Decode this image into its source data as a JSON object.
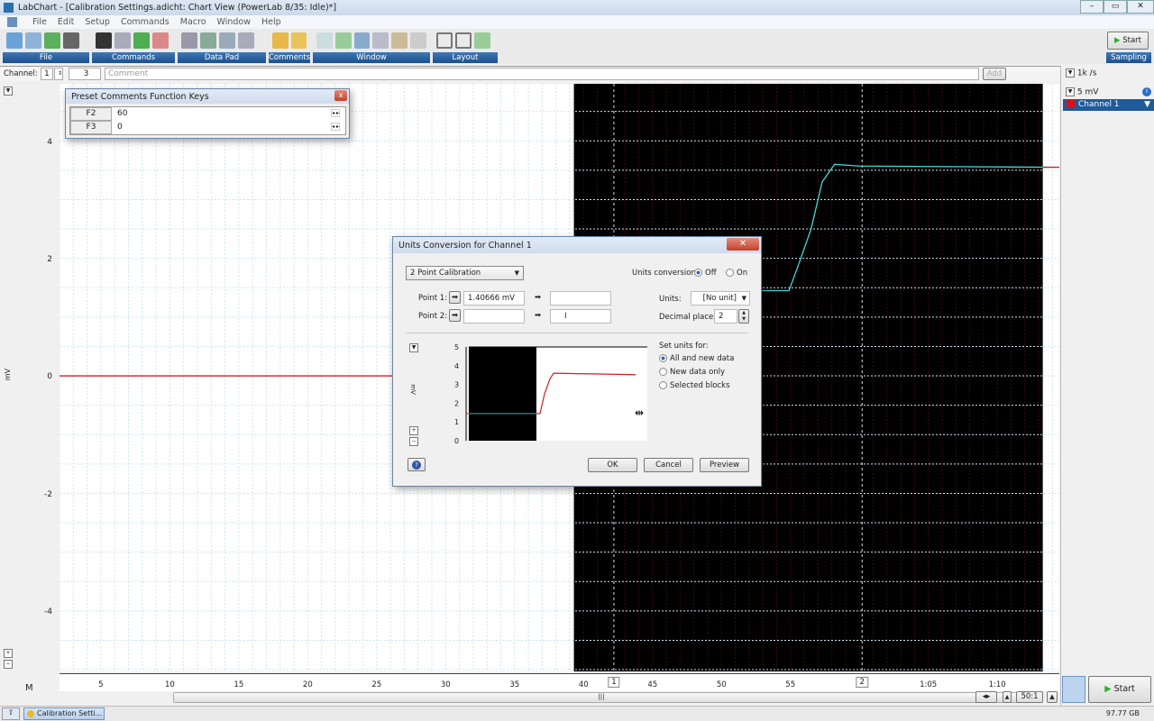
{
  "window": {
    "title": "LabChart - [Calibration Settings.adicht: Chart View (PowerLab 8/35: Idle)*]"
  },
  "menu": [
    "File",
    "Edit",
    "Setup",
    "Commands",
    "Macro",
    "Window",
    "Help"
  ],
  "toolbar": {
    "groups": [
      "File",
      "Commands",
      "Data Pad",
      "Comments",
      "Window",
      "Layout"
    ],
    "start_label": "Start",
    "sampling_label": "Sampling"
  },
  "channel_bar": {
    "label": "Channel:",
    "channel_value": "1",
    "comment_number": "3",
    "comment_placeholder": "Comment",
    "add_label": "Add"
  },
  "right_panel": {
    "rate": "1k /s",
    "range": "5 mV",
    "channel_name": "Channel 1",
    "channel_color": "#e01010"
  },
  "preset_comments": {
    "title": "Preset Comments Function Keys",
    "rows": [
      {
        "key": "F2",
        "value": "60"
      },
      {
        "key": "F3",
        "value": "0"
      }
    ]
  },
  "chart": {
    "y_unit": "mV",
    "y_ticks": [
      "4",
      "2",
      "0",
      "-2",
      "-4"
    ],
    "x_ticks": [
      "5",
      "10",
      "15",
      "20",
      "25",
      "30",
      "35",
      "40",
      "45",
      "50",
      "55",
      "1:05",
      "1:10"
    ],
    "comment_markers": [
      "1",
      "2"
    ],
    "ylim": [
      -5.03,
      4.97
    ],
    "xlim": [
      2,
      74.5
    ],
    "trace": [
      [
        2,
        0
      ],
      [
        39.3,
        0
      ],
      [
        39.3,
        1.45
      ],
      [
        54.9,
        1.45
      ],
      [
        55.6,
        1.9
      ],
      [
        56.5,
        2.5
      ],
      [
        57.3,
        3.3
      ],
      [
        58.2,
        3.6
      ],
      [
        60,
        3.57
      ],
      [
        74,
        3.55
      ]
    ],
    "selection_start": 39.3,
    "comment_times": [
      42.2,
      60.2
    ]
  },
  "dialog": {
    "title": "Units Conversion for Channel 1",
    "mode": "2 Point Calibration",
    "units_conversion_label": "Units conversion:",
    "off_label": "Off",
    "on_label": "On",
    "point1_label": "Point 1:",
    "point1_value": "1.40666 mV",
    "point2_label": "Point 2:",
    "units_label": "Units:",
    "units_value": "[No unit]",
    "decimal_label": "Decimal places:",
    "decimal_value": "2",
    "set_units_label": "Set units for:",
    "options": [
      "All and new data",
      "New data only",
      "Selected blocks"
    ],
    "preview_y_unit": "mV",
    "preview_y_ticks": [
      "5",
      "4",
      "3",
      "2",
      "1",
      "0"
    ],
    "ok": "OK",
    "cancel": "Cancel",
    "preview": "Preview"
  },
  "bottom": {
    "zoom_ratio": "50:1",
    "start_label": "Start",
    "task_label": "Calibration Setti...",
    "disk_free": "97.77 GB"
  }
}
